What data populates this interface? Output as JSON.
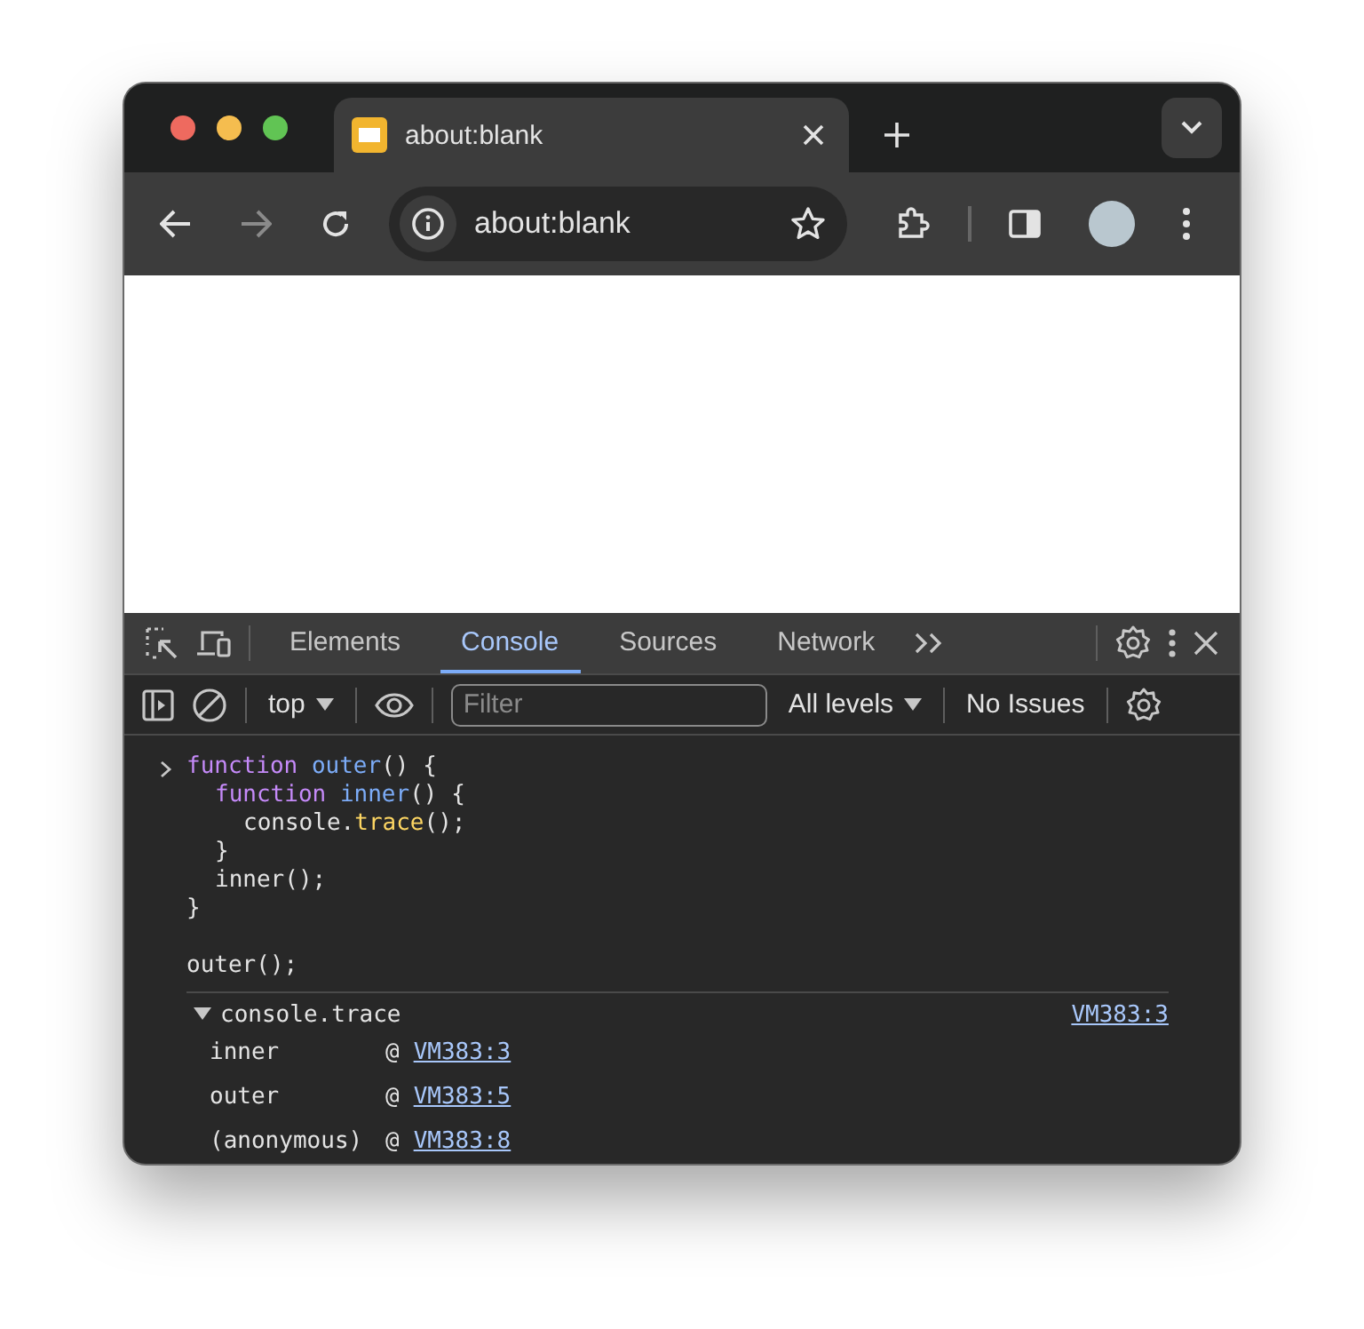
{
  "window": {
    "tab": {
      "title": "about:blank",
      "selected": true
    },
    "address": "about:blank"
  },
  "devtools": {
    "tabs": [
      {
        "label": "Elements",
        "selected": false
      },
      {
        "label": "Console",
        "selected": true
      },
      {
        "label": "Sources",
        "selected": false
      },
      {
        "label": "Network",
        "selected": false
      }
    ],
    "toolbar": {
      "context": "top",
      "filter": {
        "placeholder": "Filter"
      },
      "levels": "All levels",
      "issues": "No Issues"
    },
    "console": {
      "blocks": [
        {
          "lines": [
            {
              "tokens": [
                {
                  "text": "function ",
                  "kind": "keyword"
                },
                {
                  "text": "outer",
                  "kind": "name"
                },
                {
                  "text": "() {",
                  "kind": "plain"
                }
              ],
              "children": [
                {
                  "tokens": [
                    {
                      "text": "function ",
                      "kind": "keyword"
                    },
                    {
                      "text": "inner",
                      "kind": "name"
                    },
                    {
                      "text": "() {",
                      "kind": "plain"
                    }
                  ],
                  "children": [
                    {
                      "tokens": [
                        {
                          "text": "console.",
                          "kind": "plain"
                        },
                        {
                          "text": "trace",
                          "kind": "method"
                        },
                        {
                          "text": "();",
                          "kind": "plain"
                        }
                      ]
                    }
                  ]
                },
                {
                  "tokens": [
                    {
                      "text": "}",
                      "kind": "plain"
                    }
                  ]
                },
                {
                  "tokens": [
                    {
                      "text": "inner();",
                      "kind": "plain"
                    }
                  ]
                }
              ]
            },
            {
              "tokens": [
                {
                  "text": "}",
                  "kind": "plain"
                }
              ]
            }
          ]
        },
        {
          "lines": [
            {
              "tokens": [
                {
                  "text": "outer();",
                  "kind": "plain"
                }
              ]
            }
          ]
        }
      ],
      "trace": {
        "label": "console.trace",
        "expanded": true,
        "source": "VM383:3",
        "frames": [
          {
            "name": "inner",
            "at": "@",
            "link": "VM383:3"
          },
          {
            "name": "outer",
            "at": "@",
            "link": "VM383:5"
          },
          {
            "name": "(anonymous)",
            "at": "@",
            "link": "VM383:8"
          }
        ]
      }
    }
  }
}
